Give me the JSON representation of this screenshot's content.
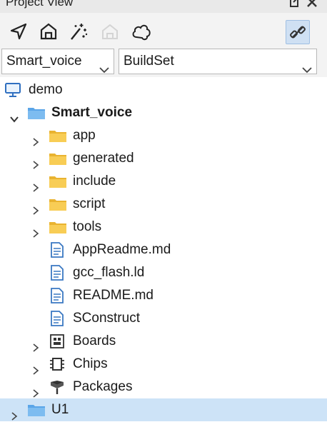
{
  "window": {
    "title": "Project View"
  },
  "toolbar": {
    "icons": [
      "navigate-icon",
      "home-icon",
      "magic-wand-icon",
      "house-disabled-icon",
      "cloud-icon",
      "link-icon"
    ]
  },
  "selectors": {
    "project": "Smart_voice",
    "build": "BuildSet"
  },
  "tree": {
    "workspace": "demo",
    "project": "Smart_voice",
    "folders": [
      "app",
      "generated",
      "include",
      "script",
      "tools"
    ],
    "files": [
      "AppReadme.md",
      "gcc_flash.ld",
      "README.md",
      "SConstruct"
    ],
    "special": [
      "Boards",
      "Chips",
      "Packages"
    ],
    "other_project": "U1"
  },
  "colors": {
    "folder": "#f5c242",
    "project_folder": "#5aa5e8",
    "selection": "#cde3f7",
    "file_icon": "#3a78c2"
  }
}
